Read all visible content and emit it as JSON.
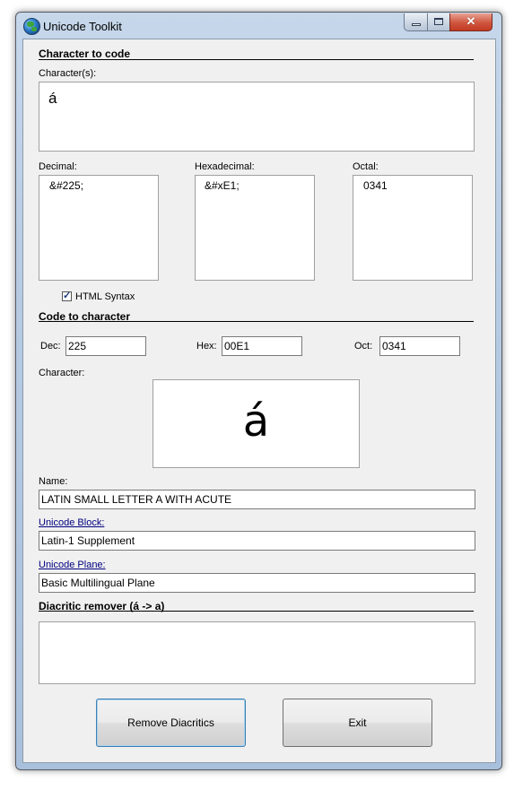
{
  "window": {
    "title": "Unicode Toolkit"
  },
  "char_to_code": {
    "section_title": "Character to code",
    "characters_label": "Character(s):",
    "characters_value": "á",
    "decimal_label": "Decimal:",
    "decimal_value": "&#225;",
    "hex_label": "Hexadecimal:",
    "hex_value": "&#xE1;",
    "octal_label": "Octal:",
    "octal_value": "0341",
    "html_syntax_label": "HTML Syntax",
    "html_syntax_checked": true
  },
  "code_to_char": {
    "section_title": "Code to character",
    "dec_label": "Dec:",
    "dec_value": "225",
    "hex_label": "Hex:",
    "hex_value": "00E1",
    "oct_label": "Oct:",
    "oct_value": "0341",
    "character_label": "Character:",
    "character_value": "á",
    "name_label": "Name:",
    "name_value": "LATIN SMALL LETTER A WITH ACUTE",
    "block_label": "Unicode Block:",
    "block_value": "Latin-1 Supplement",
    "plane_label": "Unicode Plane:",
    "plane_value": "Basic Multilingual Plane"
  },
  "diacritic": {
    "section_title": "Diacritic remover (á -> a)",
    "text_value": ""
  },
  "buttons": {
    "remove_label": "Remove Diacritics",
    "exit_label": "Exit"
  }
}
